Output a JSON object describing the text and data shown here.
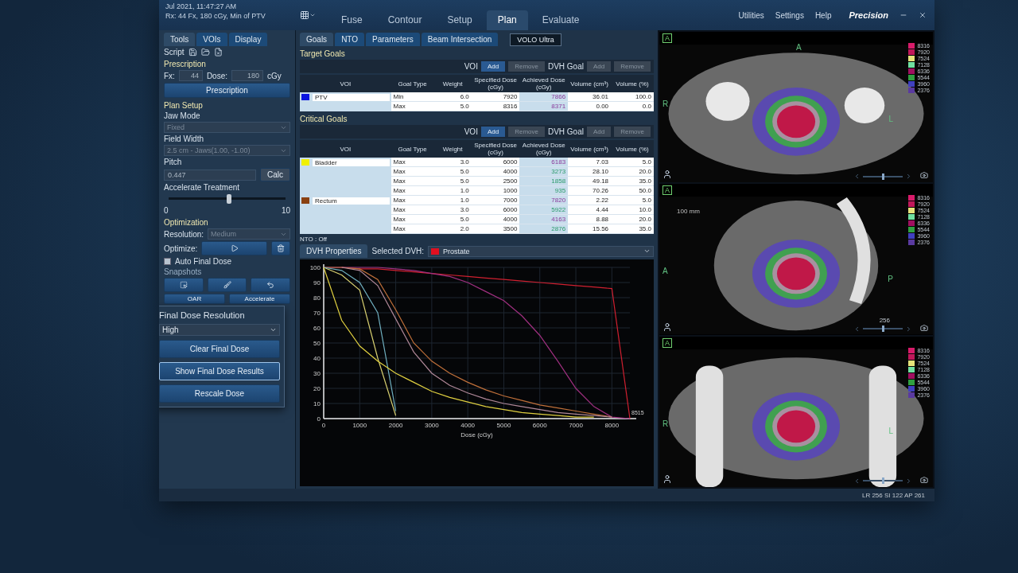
{
  "header": {
    "date": "Jul 2021, 11:47:27 AM",
    "rx": "Rx: 44 Fx, 180 cGy, Min of PTV"
  },
  "nav_tabs": [
    {
      "label": "Fuse",
      "selected": false
    },
    {
      "label": "Contour",
      "selected": false
    },
    {
      "label": "Setup",
      "selected": false
    },
    {
      "label": "Plan",
      "selected": true
    },
    {
      "label": "Evaluate",
      "selected": false
    }
  ],
  "menu": [
    "Utilities",
    "Settings",
    "Help"
  ],
  "brand": "Precision",
  "left_panel": {
    "tabs": [
      {
        "label": "Tools",
        "selected": true
      },
      {
        "label": "VOIs",
        "selected": false
      },
      {
        "label": "Display",
        "selected": false
      }
    ],
    "script_label": "Script",
    "prescription": {
      "label": "Prescription",
      "fx_label": "Fx:",
      "fx": "44",
      "dose_label": "Dose:",
      "dose": "180",
      "unit": "cGy",
      "button": "Prescription"
    },
    "plan_setup": {
      "title": "Plan Setup",
      "jaw_mode": {
        "label": "Jaw Mode",
        "value": "Fixed",
        "disabled": true
      },
      "field_width": {
        "label": "Field Width",
        "value": "2.5 cm - Jaws(1.00, -1.00)",
        "disabled": true
      },
      "pitch": {
        "label": "Pitch",
        "value": "0.447",
        "button": "Calc"
      },
      "accelerate": {
        "label": "Accelerate Treatment",
        "level": 0.52,
        "min": "0",
        "max": "10"
      }
    },
    "optimization": {
      "title": "Optimization",
      "resolution_label": "Resolution:",
      "resolution": "Medium",
      "optimize_label": "Optimize:",
      "auto_final_dose": {
        "label": "Auto Final Dose",
        "checked": false
      },
      "snapshots_label": "Snapshots",
      "snapshot_buttons": [
        "OAR",
        "Accelerate"
      ]
    },
    "final_dose_popup": {
      "title": "Final Dose Resolution",
      "value": "High",
      "buttons": [
        {
          "label": "Clear Final Dose",
          "selected": false
        },
        {
          "label": "Show Final Dose Results",
          "selected": true
        },
        {
          "label": "Rescale Dose",
          "selected": false
        }
      ]
    }
  },
  "center": {
    "tabs": [
      {
        "label": "Goals",
        "selected": true
      },
      {
        "label": "NTO",
        "selected": false
      },
      {
        "label": "Parameters",
        "selected": false
      },
      {
        "label": "Beam Intersection",
        "selected": false
      }
    ],
    "algorithm": "VOLO Ultra",
    "target_goals": {
      "title": "Target Goals",
      "voi_label": "VOI",
      "dvh_goal_label": "DVH Goal",
      "voi_actions": [
        {
          "label": "Add",
          "disabled": false
        },
        {
          "label": "Remove",
          "disabled": true
        }
      ],
      "dvh_actions": [
        {
          "label": "Add",
          "disabled": true
        },
        {
          "label": "Remove",
          "disabled": true
        }
      ],
      "columns": [
        "VOI",
        "Goal Type",
        "Weight",
        "Specified Dose (cGy)",
        "Achieved Dose (cGy)",
        "Volume (cm³)",
        "Volume (%)"
      ],
      "groups": [
        {
          "voi": "PTV",
          "color": "#0a14e0",
          "goals": [
            {
              "type": "Min",
              "weight": "6.0",
              "specified": "7920",
              "achieved": "7866",
              "met": false,
              "volume_cc": "36.01",
              "volume_pct": "100.0"
            },
            {
              "type": "Max",
              "weight": "5.0",
              "specified": "8316",
              "achieved": "8371",
              "met": false,
              "volume_cc": "0.00",
              "volume_pct": "0.0"
            }
          ]
        }
      ]
    },
    "critical_goals": {
      "title": "Critical Goals",
      "voi_label": "VOI",
      "dvh_goal_label": "DVH Goal",
      "voi_actions": [
        {
          "label": "Add",
          "disabled": false
        },
        {
          "label": "Remove",
          "disabled": true
        }
      ],
      "dvh_actions": [
        {
          "label": "Add",
          "disabled": true
        },
        {
          "label": "Remove",
          "disabled": true
        }
      ],
      "columns": [
        "VOI",
        "Goal Type",
        "Weight",
        "Specified Dose (cGy)",
        "Achieved Dose (cGy)",
        "Volume (cm³)",
        "Volume (%)"
      ],
      "groups": [
        {
          "voi": "Bladder",
          "color": "#f0f000",
          "goals": [
            {
              "type": "Max",
              "weight": "3.0",
              "specified": "6000",
              "achieved": "6183",
              "met": false,
              "volume_cc": "7.03",
              "volume_pct": "5.0"
            },
            {
              "type": "Max",
              "weight": "5.0",
              "specified": "4000",
              "achieved": "3273",
              "met": true,
              "volume_cc": "28.10",
              "volume_pct": "20.0"
            },
            {
              "type": "Max",
              "weight": "5.0",
              "specified": "2500",
              "achieved": "1858",
              "met": true,
              "volume_cc": "49.18",
              "volume_pct": "35.0"
            },
            {
              "type": "Max",
              "weight": "1.0",
              "specified": "1000",
              "achieved": "935",
              "met": true,
              "volume_cc": "70.26",
              "volume_pct": "50.0"
            }
          ]
        },
        {
          "voi": "Rectum",
          "color": "#8a4010",
          "goals": [
            {
              "type": "Max",
              "weight": "1.0",
              "specified": "7000",
              "achieved": "7820",
              "met": false,
              "volume_cc": "2.22",
              "volume_pct": "5.0"
            },
            {
              "type": "Max",
              "weight": "3.0",
              "specified": "6000",
              "achieved": "5922",
              "met": true,
              "volume_cc": "4.44",
              "volume_pct": "10.0"
            },
            {
              "type": "Max",
              "weight": "5.0",
              "specified": "4000",
              "achieved": "4163",
              "met": false,
              "volume_cc": "8.88",
              "volume_pct": "20.0"
            },
            {
              "type": "Max",
              "weight": "2.0",
              "specified": "3500",
              "achieved": "2876",
              "met": true,
              "volume_cc": "15.56",
              "volume_pct": "35.0"
            }
          ]
        }
      ]
    },
    "nto_status": "NTO : Off",
    "dvh": {
      "tab": "DVH Properties",
      "selected_label": "Selected DVH:",
      "selected": {
        "name": "Prostate",
        "color": "#e01020"
      },
      "max_label": "8515",
      "chart_data": {
        "type": "line",
        "xlabel": "Dose (cGy)",
        "grid": true,
        "x": [
          0,
          500,
          1000,
          1500,
          2000,
          2500,
          3000,
          3500,
          4000,
          4500,
          5000,
          5500,
          6000,
          6500,
          7000,
          7500,
          8000,
          8500
        ],
        "xlim": [
          0,
          8500
        ],
        "ylim": [
          0,
          100
        ],
        "xticks": [
          0,
          1000,
          2000,
          3000,
          4000,
          5000,
          6000,
          7000,
          8000
        ],
        "yticks": [
          0,
          10,
          20,
          30,
          40,
          50,
          60,
          70,
          80,
          90,
          100
        ],
        "series": [
          {
            "color": "#d02030",
            "values": [
              null,
              100,
              99,
              99,
              98,
              97,
              96,
              95,
              94,
              93,
              92,
              91,
              90,
              89,
              88,
              87,
              86,
              0
            ]
          },
          {
            "color": "#a03080",
            "values": [
              100,
              100,
              100,
              100,
              99,
              98,
              96,
              94,
              90,
              84,
              78,
              68,
              55,
              38,
              20,
              8,
              1,
              0
            ]
          },
          {
            "color": "#c0703a",
            "values": [
              100,
              100,
              99,
              92,
              72,
              50,
              38,
              30,
              24,
              19,
              15,
              12,
              9,
              7,
              5,
              3,
              1,
              null
            ]
          },
          {
            "color": "#b08898",
            "values": [
              null,
              100,
              98,
              88,
              66,
              44,
              30,
              22,
              17,
              13,
              10,
              8,
              6,
              4,
              3,
              2,
              1,
              null
            ]
          },
          {
            "color": "#d8d070",
            "values": [
              100,
              95,
              85,
              40,
              2,
              null,
              null,
              null,
              null,
              null,
              null,
              null,
              null,
              null,
              null,
              null,
              null,
              null
            ]
          },
          {
            "color": "#70b0c0",
            "values": [
              100,
              98,
              90,
              70,
              5,
              null,
              null,
              null,
              null,
              null,
              null,
              null,
              null,
              null,
              null,
              null,
              null,
              null
            ]
          },
          {
            "color": "#e0d040",
            "values": [
              100,
              65,
              48,
              38,
              30,
              24,
              18,
              14,
              11,
              8,
              6,
              4,
              3,
              2,
              1,
              1,
              null,
              null
            ]
          }
        ]
      }
    }
  },
  "views": [
    {
      "kind": "axial",
      "badge": "A",
      "orientation": [
        "A",
        "R",
        "L"
      ],
      "slider": {
        "level": 0.5
      },
      "legend": [
        {
          "value": "8316",
          "color": "#d81b6a"
        },
        {
          "value": "7920",
          "color": "#c0185a"
        },
        {
          "value": "7524",
          "color": "#e6e37a"
        },
        {
          "value": "7128",
          "color": "#70e0a0"
        },
        {
          "value": "6336",
          "color": "#a01060"
        },
        {
          "value": "5544",
          "color": "#30a040"
        },
        {
          "value": "3960",
          "color": "#4040c0"
        },
        {
          "value": "2376",
          "color": "#5a3aa0"
        }
      ]
    },
    {
      "kind": "sagittal",
      "badge": "A",
      "orientation": [
        "A",
        "P"
      ],
      "slice": "256",
      "slider": {
        "level": 0.5
      },
      "scale": "100 mm",
      "legend": [
        {
          "value": "8316",
          "color": "#d81b6a"
        },
        {
          "value": "7920",
          "color": "#c0185a"
        },
        {
          "value": "7524",
          "color": "#e6e37a"
        },
        {
          "value": "7128",
          "color": "#70e0a0"
        },
        {
          "value": "6336",
          "color": "#a01060"
        },
        {
          "value": "5544",
          "color": "#30a040"
        },
        {
          "value": "3960",
          "color": "#4040c0"
        },
        {
          "value": "2376",
          "color": "#5a3aa0"
        }
      ]
    },
    {
      "kind": "coronal",
      "badge": "A",
      "orientation": [
        "R",
        "L"
      ],
      "slider": {
        "level": 0.5
      },
      "legend": [
        {
          "value": "8316",
          "color": "#d81b6a"
        },
        {
          "value": "7920",
          "color": "#c0185a"
        },
        {
          "value": "7524",
          "color": "#e6e37a"
        },
        {
          "value": "7128",
          "color": "#70e0a0"
        },
        {
          "value": "6336",
          "color": "#a01060"
        },
        {
          "value": "5544",
          "color": "#30a040"
        },
        {
          "value": "3960",
          "color": "#4040c0"
        },
        {
          "value": "2376",
          "color": "#5a3aa0"
        }
      ]
    }
  ],
  "status": "LR 256 SI 122 AP 261"
}
